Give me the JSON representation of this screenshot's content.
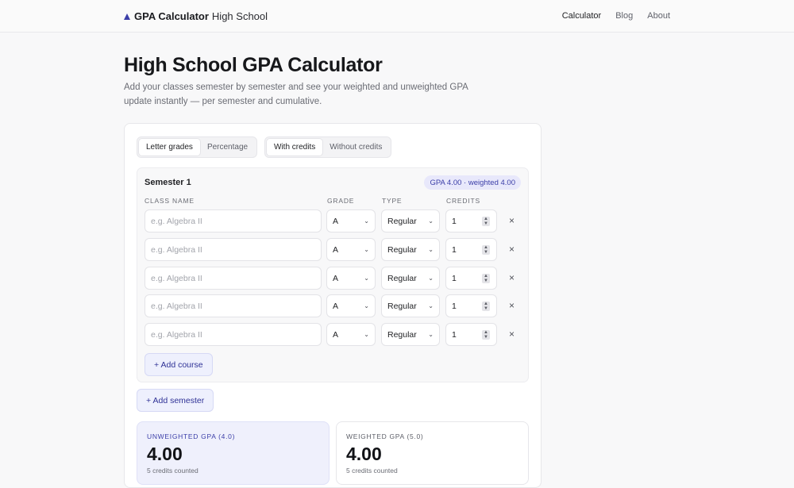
{
  "brand": {
    "name_bold": "GPA Calculator",
    "name_rest": "High School"
  },
  "nav": [
    {
      "label": "Calculator",
      "active": true
    },
    {
      "label": "Blog",
      "active": false
    },
    {
      "label": "About",
      "active": false
    }
  ],
  "page": {
    "title": "High School GPA Calculator",
    "subtitle": "Add your classes semester by semester and see your weighted and unweighted GPA update instantly — per semester and cumulative."
  },
  "toggles": {
    "grade_mode": {
      "options": [
        "Letter grades",
        "Percentage"
      ],
      "selected": "Letter grades"
    },
    "credit_mode": {
      "options": [
        "With credits",
        "Without credits"
      ],
      "selected": "With credits"
    }
  },
  "semester": {
    "title": "Semester 1",
    "gpa_badge": "GPA 4.00 · weighted 4.00",
    "columns": {
      "name": "CLASS NAME",
      "grade": "GRADE",
      "type": "TYPE",
      "credits": "CREDITS"
    },
    "rows": [
      {
        "placeholder": "e.g. Algebra II",
        "grade": "A",
        "type": "Regular",
        "credits": "1"
      },
      {
        "placeholder": "e.g. Algebra II",
        "grade": "A",
        "type": "Regular",
        "credits": "1"
      },
      {
        "placeholder": "e.g. Algebra II",
        "grade": "A",
        "type": "Regular",
        "credits": "1"
      },
      {
        "placeholder": "e.g. Algebra II",
        "grade": "A",
        "type": "Regular",
        "credits": "1"
      },
      {
        "placeholder": "e.g. Algebra II",
        "grade": "A",
        "type": "Regular",
        "credits": "1"
      }
    ],
    "remove_glyph": "×",
    "add_course_label": "+ Add course"
  },
  "add_semester_label": "+ Add semester",
  "stats": {
    "unweighted": {
      "label": "UNWEIGHTED GPA (4.0)",
      "value": "4.00",
      "meta": "5 credits counted"
    },
    "weighted": {
      "label": "WEIGHTED GPA (5.0)",
      "value": "4.00",
      "meta": "5 credits counted"
    }
  },
  "icons": {
    "brand": "triangle-logo-icon",
    "select": "chevron-down-icon",
    "stepper": "stepper-icon",
    "remove": "close-icon"
  },
  "colors": {
    "accent": "#3b3ea8",
    "accent_soft": "#eef0fd"
  }
}
